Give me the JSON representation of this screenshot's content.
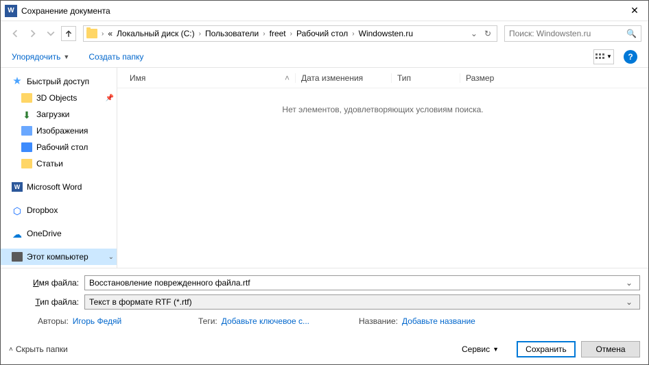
{
  "title": "Сохранение документа",
  "breadcrumb": {
    "prefix": "«",
    "items": [
      "Локальный диск (C:)",
      "Пользователи",
      "freet",
      "Рабочий стол",
      "Windowsten.ru"
    ]
  },
  "search": {
    "placeholder": "Поиск: Windowsten.ru"
  },
  "toolbar": {
    "organize": "Упорядочить",
    "new_folder": "Создать папку",
    "help": "?"
  },
  "columns": {
    "name": "Имя",
    "date": "Дата изменения",
    "type": "Тип",
    "size": "Размер"
  },
  "empty_message": "Нет элементов, удовлетворяющих условиям поиска.",
  "sidebar": {
    "quick": "Быстрый доступ",
    "items": [
      {
        "label": "3D Objects",
        "icon": "folder",
        "pinned": true
      },
      {
        "label": "Загрузки",
        "icon": "down",
        "pinned": false
      },
      {
        "label": "Изображения",
        "icon": "img",
        "pinned": false
      },
      {
        "label": "Рабочий стол",
        "icon": "desk",
        "pinned": false
      },
      {
        "label": "Статьи",
        "icon": "folder",
        "pinned": false
      }
    ],
    "word": "Microsoft Word",
    "dropbox": "Dropbox",
    "onedrive": "OneDrive",
    "pc": "Этот компьютер"
  },
  "file": {
    "name_label": "Имя файла:",
    "name_value": "Восстановление поврежденного файла.rtf",
    "type_label": "Тип файла:",
    "type_value": "Текст в формате RTF (*.rtf)"
  },
  "meta": {
    "authors_label": "Авторы:",
    "authors_value": "Игорь Федяй",
    "tags_label": "Теги:",
    "tags_value": "Добавьте ключевое с...",
    "title_label": "Название:",
    "title_value": "Добавьте название"
  },
  "actions": {
    "hide_folders": "Скрыть папки",
    "service": "Сервис",
    "save": "Сохранить",
    "cancel": "Отмена"
  },
  "name_underline": "И",
  "type_underline": "Т",
  "save_underline": "С"
}
